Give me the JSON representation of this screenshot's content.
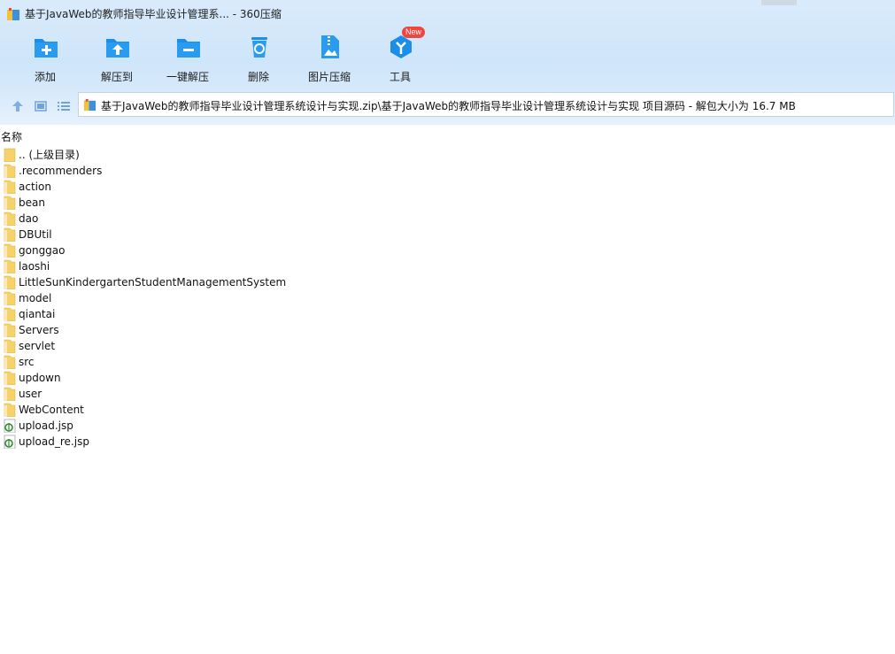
{
  "window": {
    "title": "基于JavaWeb的教师指导毕业设计管理系... - 360压缩"
  },
  "toolbar": {
    "items": [
      {
        "label": "添加",
        "icon": "add-icon"
      },
      {
        "label": "解压到",
        "icon": "extract-to-icon"
      },
      {
        "label": "一键解压",
        "icon": "one-click-extract-icon"
      },
      {
        "label": "删除",
        "icon": "delete-icon"
      },
      {
        "label": "图片压缩",
        "icon": "image-compress-icon"
      },
      {
        "label": "工具",
        "icon": "tools-icon"
      }
    ],
    "new_badge": "New"
  },
  "nav": {
    "path": "基于JavaWeb的教师指导毕业设计管理系统设计与实现.zip\\基于JavaWeb的教师指导毕业设计管理系统设计与实现 项目源码 - 解包大小为 16.7 MB"
  },
  "columns": {
    "name": "名称"
  },
  "files": [
    {
      "name": ".. (上级目录)",
      "type": "folder"
    },
    {
      "name": ".recommenders",
      "type": "folder-doc"
    },
    {
      "name": "action",
      "type": "folder-doc"
    },
    {
      "name": "bean",
      "type": "folder-doc"
    },
    {
      "name": "dao",
      "type": "folder-doc"
    },
    {
      "name": "DBUtil",
      "type": "folder-doc"
    },
    {
      "name": "gonggao",
      "type": "folder-doc"
    },
    {
      "name": "laoshi",
      "type": "folder-doc"
    },
    {
      "name": "LittleSunKindergartenStudentManagementSystem",
      "type": "folder-doc"
    },
    {
      "name": "model",
      "type": "folder-doc"
    },
    {
      "name": "qiantai",
      "type": "folder-doc"
    },
    {
      "name": "Servers",
      "type": "folder-doc"
    },
    {
      "name": "servlet",
      "type": "folder-doc"
    },
    {
      "name": "src",
      "type": "folder-doc"
    },
    {
      "name": "updown",
      "type": "folder-doc"
    },
    {
      "name": "user",
      "type": "folder-doc"
    },
    {
      "name": "WebContent",
      "type": "folder-doc"
    },
    {
      "name": "upload.jsp",
      "type": "jsp"
    },
    {
      "name": "upload_re.jsp",
      "type": "jsp"
    }
  ],
  "colors": {
    "accent": "#1b8ee8",
    "folder": "#f6d36a",
    "badge": "#f2453d"
  }
}
